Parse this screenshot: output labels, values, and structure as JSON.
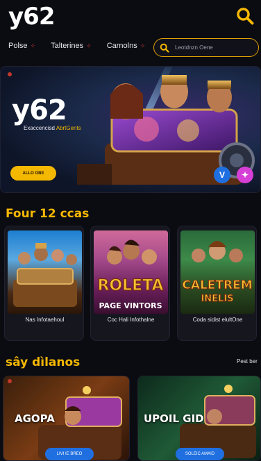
{
  "header": {
    "logo": "y62",
    "nav": [
      {
        "label": "Polse"
      },
      {
        "label": "Talterines"
      },
      {
        "label": "Carnolns"
      }
    ],
    "search_placeholder": "Leotdnzn Oene"
  },
  "hero": {
    "brand": "y62",
    "tagline_a": "Exaccencisd",
    "tagline_b": "AbrtGents",
    "cta": "ALLO OBE",
    "btn1": "V",
    "btn2": "✦"
  },
  "sections": {
    "featured_title": "Four 12 ccas",
    "live_title": "sây dìlanos",
    "see_more": "Pest ber"
  },
  "cards": [
    {
      "caption": "Nas Infotaehoul",
      "art": "railcar-figures"
    },
    {
      "caption": "Coc Hali Infothalne",
      "art": "roleta",
      "art_title": "ROLETA",
      "art_sub": "PAGE VINTORS"
    },
    {
      "caption": "Coda sidist elultOne",
      "art": "caletrem",
      "art_title": "CALETREM",
      "art_sub": "INELIS"
    }
  ],
  "wide_cards": [
    {
      "title": "AGOPA",
      "button": "LIVI IE BREO"
    },
    {
      "title": "UPOIL GID",
      "button": "SOLEIC AMAID"
    }
  ],
  "colors": {
    "accent": "#f5b800",
    "background": "#0b0b12",
    "blue": "#1f6fe0",
    "pink": "#d63fd6"
  }
}
